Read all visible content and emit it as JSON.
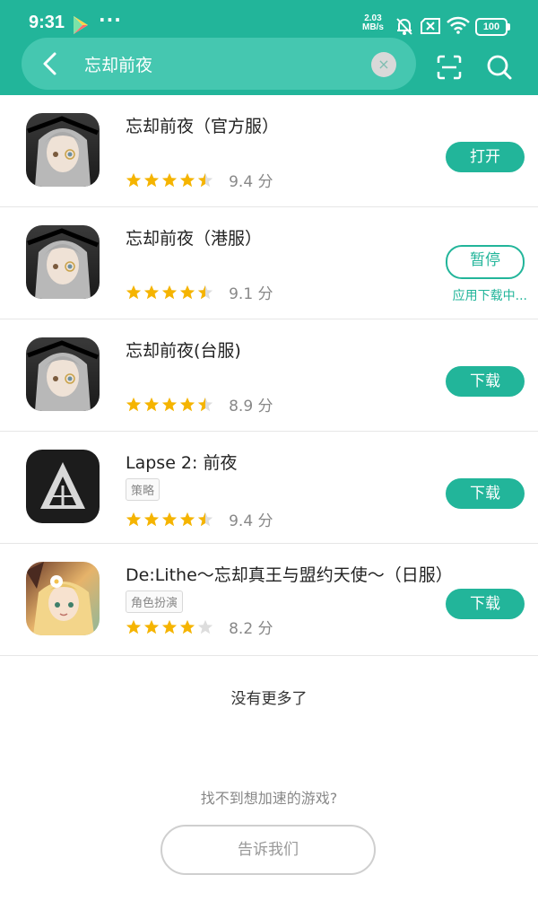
{
  "status_bar": {
    "time": "9:31",
    "dots": "···",
    "net_speed_value": "2.03",
    "net_speed_unit": "MB/s",
    "battery": "100"
  },
  "search": {
    "query": "忘却前夜",
    "clear_symbol": "×"
  },
  "colors": {
    "accent": "#22b59a",
    "star": "#f5b400",
    "star_empty": "#dddddd"
  },
  "apps": [
    {
      "name": "忘却前夜（官方服）",
      "rating": 4.5,
      "score": "9.4 分",
      "button": "打开",
      "button_style": "solid",
      "icon": "anime-portrait-icon"
    },
    {
      "name": "忘却前夜（港服）",
      "rating": 4.5,
      "score": "9.1 分",
      "button": "暂停",
      "button_style": "outline",
      "download_status": "应用下载中...",
      "icon": "anime-portrait-icon"
    },
    {
      "name": "忘却前夜(台服)",
      "rating": 4.5,
      "score": "8.9 分",
      "button": "下载",
      "button_style": "solid",
      "icon": "anime-portrait-icon"
    },
    {
      "name": "Lapse 2: 前夜",
      "tag": "策略",
      "rating": 4.5,
      "score": "9.4 分",
      "button": "下载",
      "button_style": "solid",
      "icon": "triangle-logo-icon"
    },
    {
      "name": "De:Lithe～忘却真王与盟约天使～（日服）",
      "tag": "角色扮演",
      "rating": 4,
      "score": "8.2 分",
      "button": "下载",
      "button_style": "solid",
      "icon": "anime-girl-icon"
    }
  ],
  "footer": {
    "end_text": "没有更多了",
    "hint": "找不到想加速的游戏?",
    "tell_button": "告诉我们"
  }
}
